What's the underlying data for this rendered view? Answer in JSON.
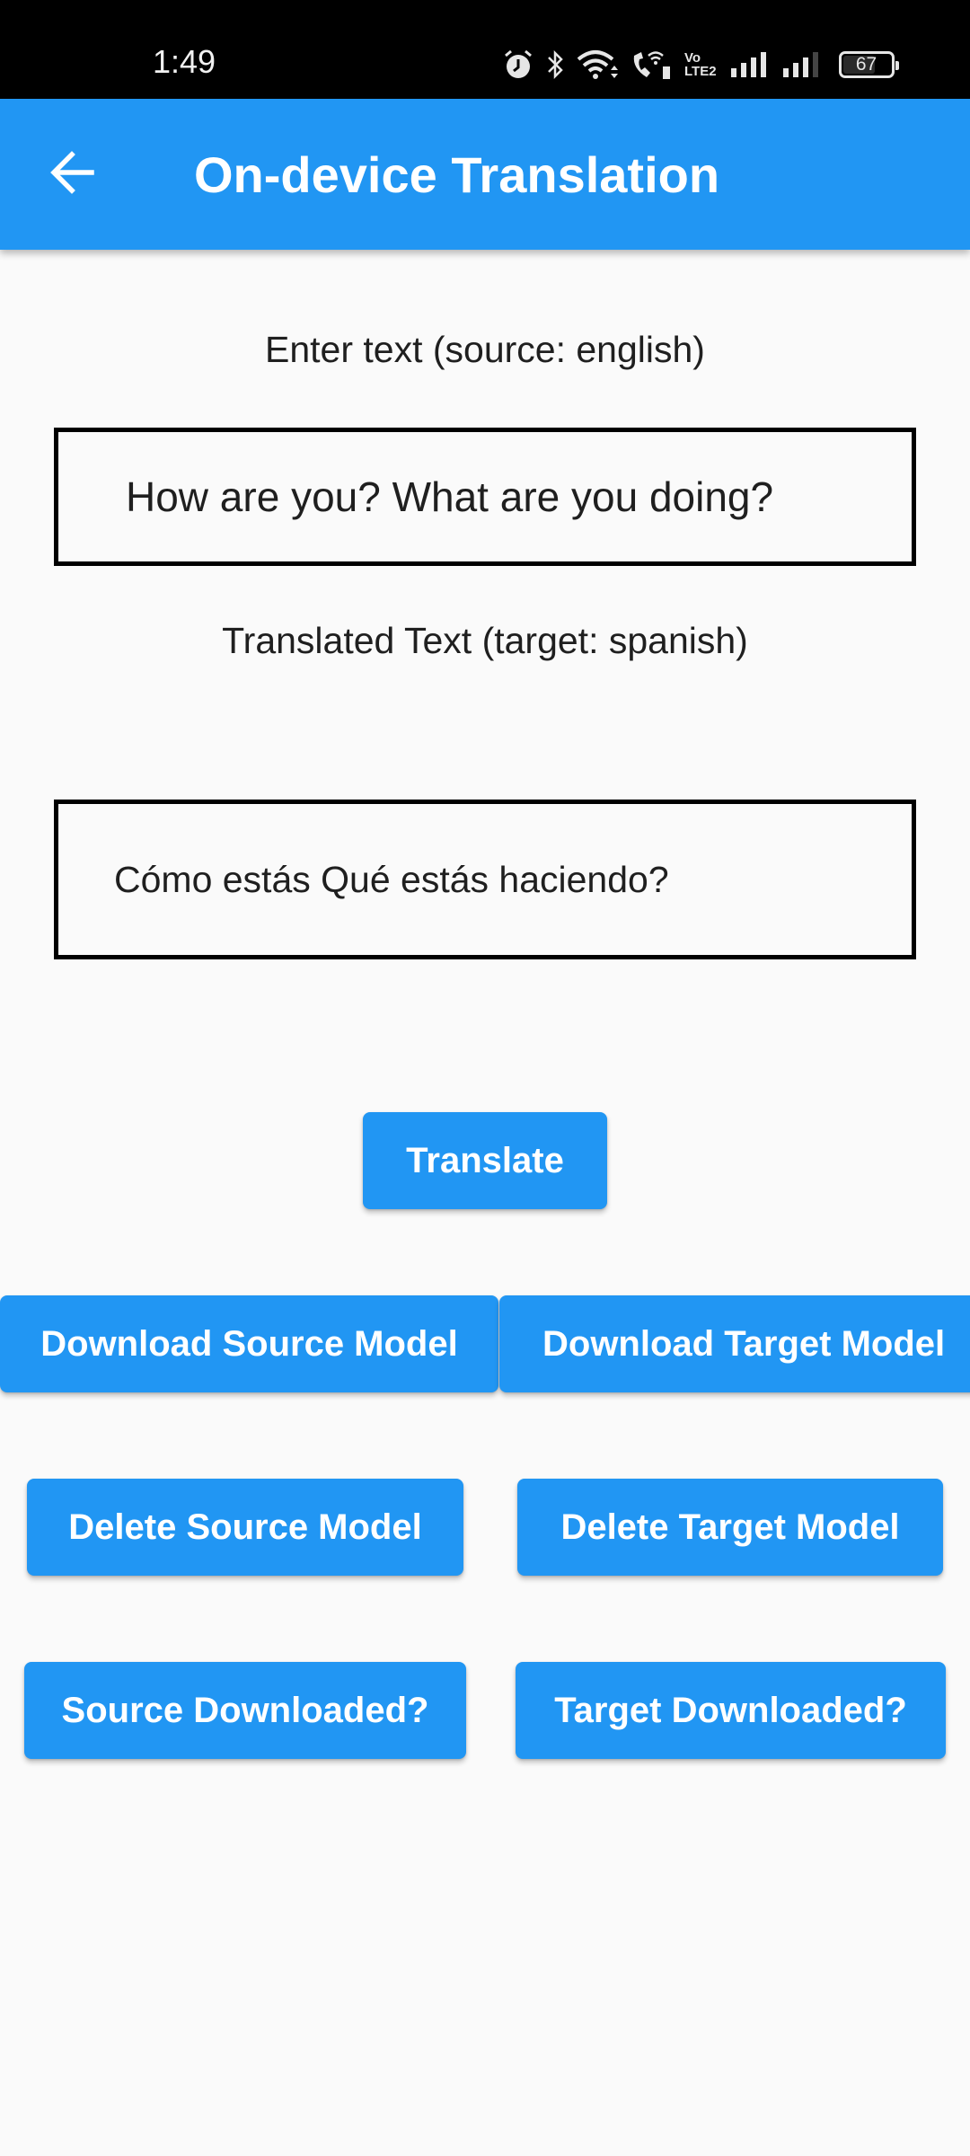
{
  "status_bar": {
    "time": "1:49",
    "icons": [
      "alarm-icon",
      "bluetooth-icon",
      "wifi-icon",
      "wifi-calling-icon",
      "volte-2-icon",
      "signal-sim1-icon",
      "signal-sim2-icon"
    ],
    "volte_label_top": "Vo",
    "volte_label_bottom": "LTE2",
    "battery_percent": "67"
  },
  "app_bar": {
    "back_icon": "arrow-back-icon",
    "title": "On-device Translation",
    "color": "#2196F3"
  },
  "source": {
    "label": "Enter text (source: english)",
    "value": "How are you? What are you doing?"
  },
  "target": {
    "label": "Translated Text (target: spanish)",
    "value": "Cómo estás Qué estás haciendo?"
  },
  "buttons": {
    "translate": "Translate",
    "download_source": "Download Source Model",
    "download_target": "Download Target Model",
    "delete_source": "Delete Source Model",
    "delete_target": "Delete Target Model",
    "source_downloaded": "Source Downloaded?",
    "target_downloaded": "Target Downloaded?"
  }
}
